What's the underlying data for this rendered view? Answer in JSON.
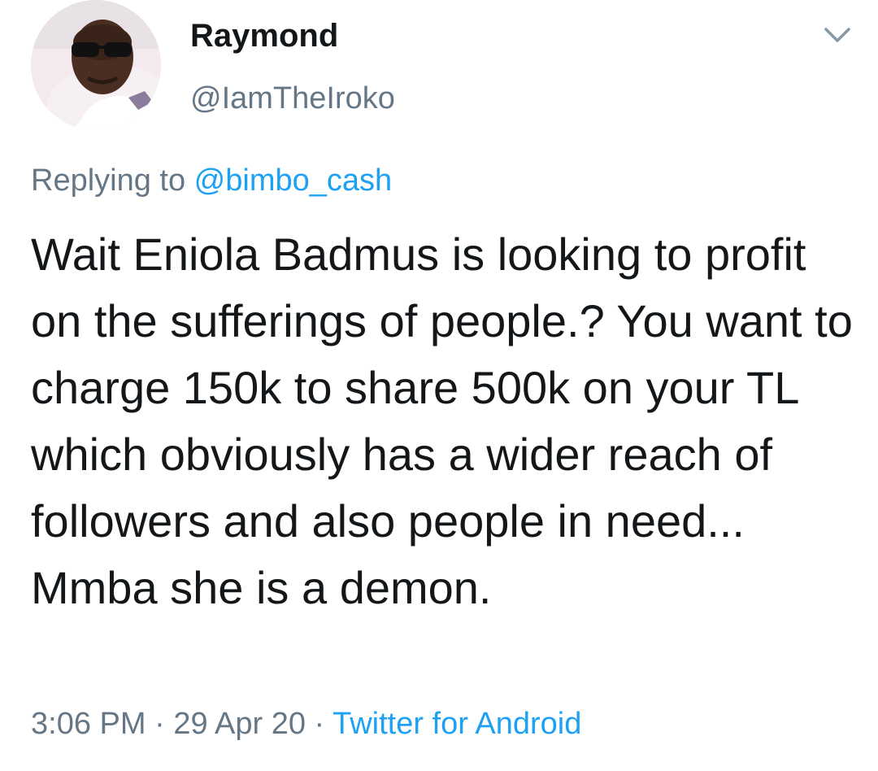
{
  "user": {
    "display_name": "Raymond",
    "handle": "@IamTheIroko"
  },
  "reply": {
    "prefix": "Replying to ",
    "mention": "@bimbo_cash"
  },
  "tweet": {
    "text": "Wait Eniola Badmus is looking to profit on the sufferings of people.? You want to charge 150k to share 500k on your TL which obviously has a wider reach of followers and also people in need...  Mmba she is a demon."
  },
  "meta": {
    "time": "3:06 PM",
    "separator": " · ",
    "date": "29 Apr 20",
    "source": "Twitter for Android"
  },
  "icons": {
    "menu": "chevron-down-icon"
  },
  "colors": {
    "text": "#14171a",
    "secondary": "#657786",
    "link": "#1da1f2"
  }
}
